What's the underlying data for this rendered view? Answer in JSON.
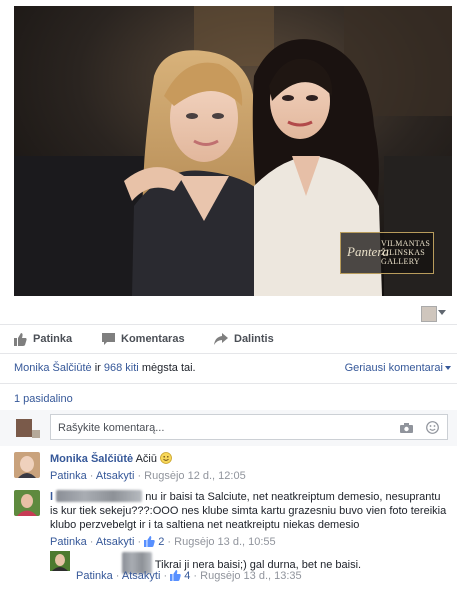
{
  "photo": {
    "watermark_brand": "Pantera",
    "watermark_name_line1": "VILMANTAS",
    "watermark_name_line2": "ŽILINSKAS",
    "watermark_name_line3": "GALLERY"
  },
  "actions": {
    "like": "Patinka",
    "comment": "Komentaras",
    "share": "Dalintis"
  },
  "likes": {
    "name": "Monika Šalčiūtė",
    "conj": "ir",
    "others": "968 kiti",
    "suffix": "mėgsta tai.",
    "sort_label": "Geriausi komentarai"
  },
  "shares_label": "1 pasidalino",
  "composer": {
    "placeholder": "Rašykite komentarą..."
  },
  "comments": [
    {
      "author": "Monika Šalčiūtė",
      "text": "Ačiū",
      "like": "Patinka",
      "reply": "Atsakyti",
      "time": "Rugsėjo 12 d., 12:05"
    },
    {
      "author_initial": "l",
      "text_line1": "nu ir baisi ta Salciute, net neatkreiptum demesio, nesuprantu",
      "text_line2": "is kur tiek sekeju???:OOO nes klube simta kartu grazesniu buvo vien foto tereikia",
      "text_line3": "klubo perzvebelgt ir i ta saltiena net neatkreiptu niekas demesio",
      "like": "Patinka",
      "reply": "Atsakyti",
      "likes_count": "2",
      "time": "Rugsėjo 13 d., 10:55"
    },
    {
      "text": "Tikrai ji nera baisi;) gal durna, bet ne baisi.",
      "like": "Patinka",
      "reply": "Atsakyti",
      "likes_count": "4",
      "time": "Rugsėjo 13 d., 13:35"
    }
  ],
  "colors": {
    "link": "#365899",
    "muted": "#90949c",
    "text": "#1d2129"
  }
}
